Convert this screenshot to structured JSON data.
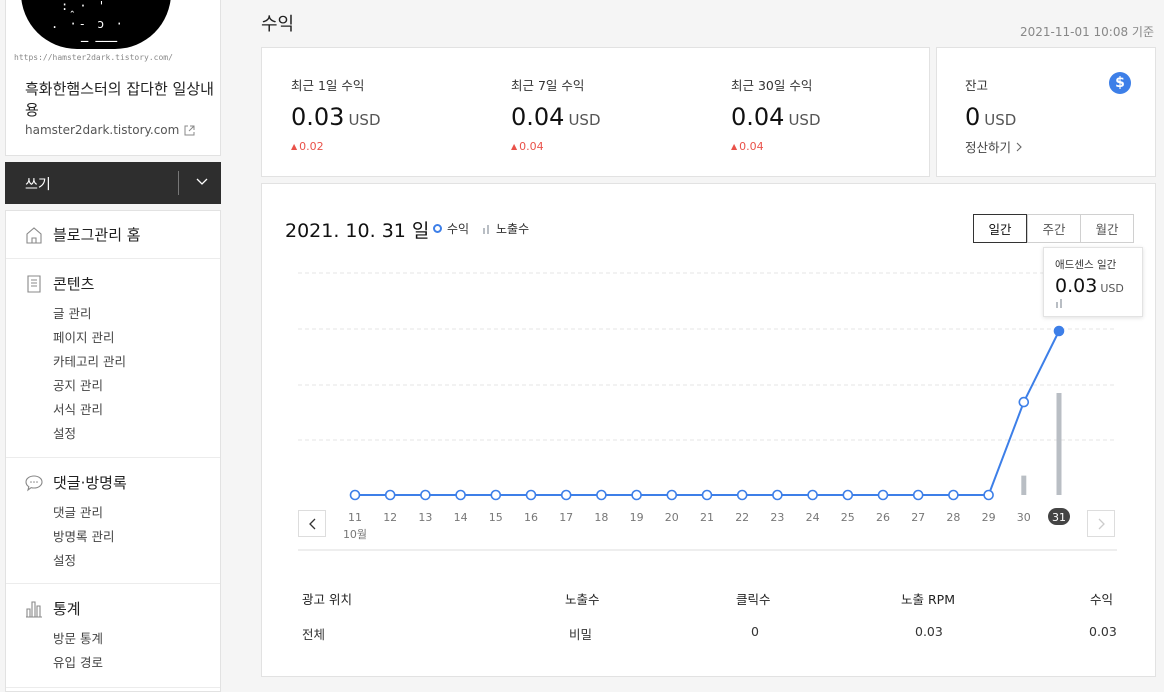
{
  "blog": {
    "avatar_url": "https://hamster2dark.tistory.com/",
    "title": "흑화한햄스터의 잡다한 일상내용",
    "domain": "hamster2dark.tistory.com"
  },
  "write": {
    "label": "쓰기"
  },
  "menu": {
    "home": "블로그관리 홈",
    "content": {
      "label": "콘텐츠",
      "items": [
        "글 관리",
        "페이지 관리",
        "카테고리 관리",
        "공지 관리",
        "서식 관리",
        "설정"
      ]
    },
    "comments": {
      "label": "댓글·방명록",
      "items": [
        "댓글 관리",
        "방명록 관리",
        "설정"
      ]
    },
    "stats": {
      "label": "통계",
      "items": [
        "방문 통계",
        "유입 경로"
      ]
    }
  },
  "page": {
    "title": "수익",
    "timestamp": "2021-11-01 10:08 기준"
  },
  "summary": [
    {
      "label": "최근 1일 수익",
      "value": "0.03",
      "unit": "USD",
      "delta": "0.02"
    },
    {
      "label": "최근 7일 수익",
      "value": "0.04",
      "unit": "USD",
      "delta": "0.04"
    },
    {
      "label": "최근 30일 수익",
      "value": "0.04",
      "unit": "USD",
      "delta": "0.04"
    }
  ],
  "balance": {
    "label": "잔고",
    "value": "0",
    "unit": "USD",
    "settle": "정산하기"
  },
  "chart_header": {
    "date": "2021. 10. 31 일",
    "legend_revenue": "수익",
    "legend_impressions": "노출수",
    "tabs": [
      "일간",
      "주간",
      "월간"
    ],
    "active_tab": "일간"
  },
  "tooltip": {
    "title": "애드센스 일간",
    "value": "0.03",
    "unit": "USD"
  },
  "colors": {
    "accent": "#3d7fe8",
    "impressions": "#b9bec4",
    "delta": "#e9524a"
  },
  "chart_data": {
    "type": "line",
    "month_label": "10월",
    "categories": [
      "11",
      "12",
      "13",
      "14",
      "15",
      "16",
      "17",
      "18",
      "19",
      "20",
      "21",
      "22",
      "23",
      "24",
      "25",
      "26",
      "27",
      "28",
      "29",
      "30",
      "31"
    ],
    "series": [
      {
        "name": "수익",
        "values": [
          0,
          0,
          0,
          0,
          0,
          0,
          0,
          0,
          0,
          0,
          0,
          0,
          0,
          0,
          0,
          0,
          0,
          0,
          0,
          0.017,
          0.03
        ]
      },
      {
        "name": "노출수",
        "values": [
          0,
          0,
          0,
          0,
          0,
          0,
          0,
          0,
          0,
          0,
          0,
          0,
          0,
          0,
          0,
          0,
          0,
          0,
          0,
          0.19,
          1
        ]
      }
    ],
    "selected_category": "31"
  },
  "table": {
    "headers": [
      "광고 위치",
      "노출수",
      "클릭수",
      "노출 RPM",
      "수익"
    ],
    "rows": [
      [
        "전체",
        "비밀",
        "0",
        "0.03",
        "0.03"
      ]
    ]
  }
}
